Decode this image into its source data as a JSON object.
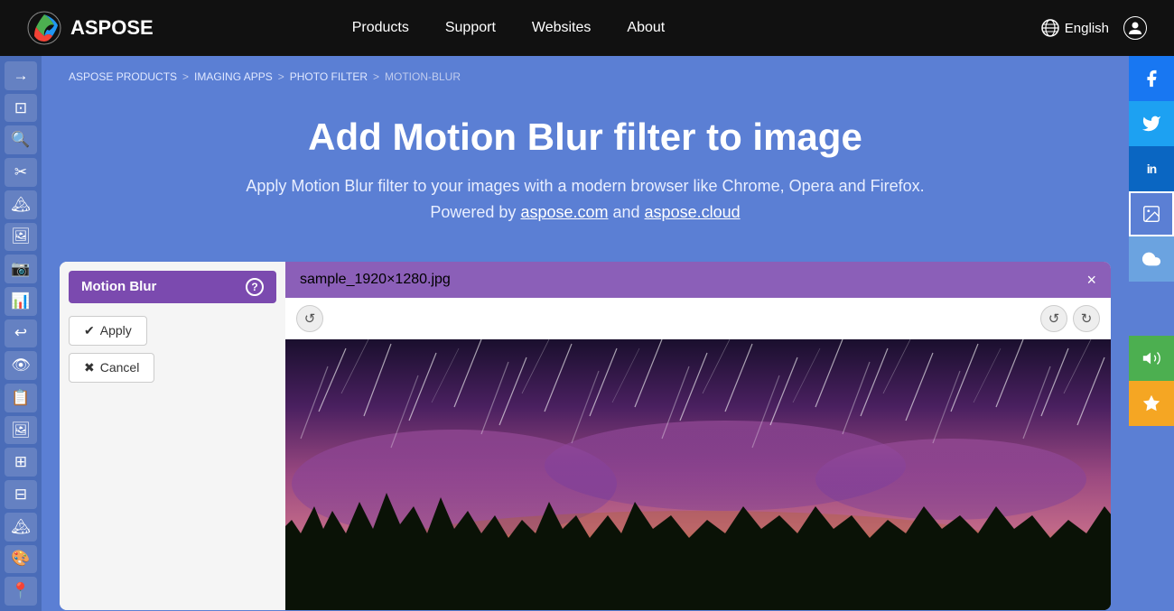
{
  "brand": {
    "name": "ASPOSE"
  },
  "navbar": {
    "links": [
      {
        "label": "Products",
        "id": "products"
      },
      {
        "label": "Support",
        "id": "support"
      },
      {
        "label": "Websites",
        "id": "websites"
      },
      {
        "label": "About",
        "id": "about"
      }
    ],
    "language": "English",
    "language_icon": "globe-icon"
  },
  "breadcrumb": {
    "items": [
      {
        "label": "ASPOSE PRODUCTS",
        "id": "aspose-products"
      },
      {
        "label": "IMAGING APPS",
        "id": "imaging-apps"
      },
      {
        "label": "PHOTO FILTER",
        "id": "photo-filter"
      },
      {
        "label": "MOTION-BLUR",
        "id": "motion-blur-bc"
      }
    ]
  },
  "hero": {
    "title": "Add Motion Blur filter to image",
    "subtitle": "Apply Motion Blur filter to your images with a modern browser like Chrome, Opera and Firefox.",
    "powered_by_prefix": "Powered by ",
    "link1": "aspose.com",
    "powered_by_middle": " and ",
    "link2": "aspose.cloud"
  },
  "editor": {
    "file_name": "sample_1920×1280.jpg",
    "filter_label": "Motion Blur",
    "help_icon": "?",
    "apply_label": "Apply",
    "cancel_label": "Cancel",
    "close_label": "×",
    "undo_icon": "↺",
    "redo_icon": "↻",
    "refresh_icon": "↺"
  },
  "sidebar_tools": [
    {
      "icon": "→",
      "label": "forward-tool"
    },
    {
      "icon": "⊡",
      "label": "select-tool"
    },
    {
      "icon": "🔍",
      "label": "zoom-tool"
    },
    {
      "icon": "✂",
      "label": "crop-tool"
    },
    {
      "icon": "🏔",
      "label": "landscape-tool"
    },
    {
      "icon": "🖼",
      "label": "image-tool"
    },
    {
      "icon": "📷",
      "label": "camera-tool"
    },
    {
      "icon": "📊",
      "label": "chart-tool"
    },
    {
      "icon": "↩",
      "label": "undo-tool"
    },
    {
      "icon": "👁",
      "label": "view-tool"
    },
    {
      "icon": "📋",
      "label": "clipboard-tool"
    },
    {
      "icon": "🖼",
      "label": "gallery-tool"
    },
    {
      "icon": "⊞",
      "label": "grid-tool"
    },
    {
      "icon": "⊡",
      "label": "frame-tool"
    },
    {
      "icon": "🏔",
      "label": "mountain-tool"
    },
    {
      "icon": "🎨",
      "label": "paint-tool"
    },
    {
      "icon": "📍",
      "label": "pin-tool"
    }
  ],
  "social": [
    {
      "icon": "f",
      "label": "facebook",
      "class": "social-fb"
    },
    {
      "icon": "t",
      "label": "twitter",
      "class": "social-tw"
    },
    {
      "icon": "in",
      "label": "linkedin",
      "class": "social-li"
    },
    {
      "icon": "🖼",
      "label": "image-share",
      "class": "social-img"
    },
    {
      "icon": "☁",
      "label": "cloud",
      "class": "social-cloud"
    },
    {
      "icon": "📢",
      "label": "announce",
      "class": "social-announce"
    },
    {
      "icon": "★",
      "label": "star",
      "class": "social-star"
    }
  ]
}
